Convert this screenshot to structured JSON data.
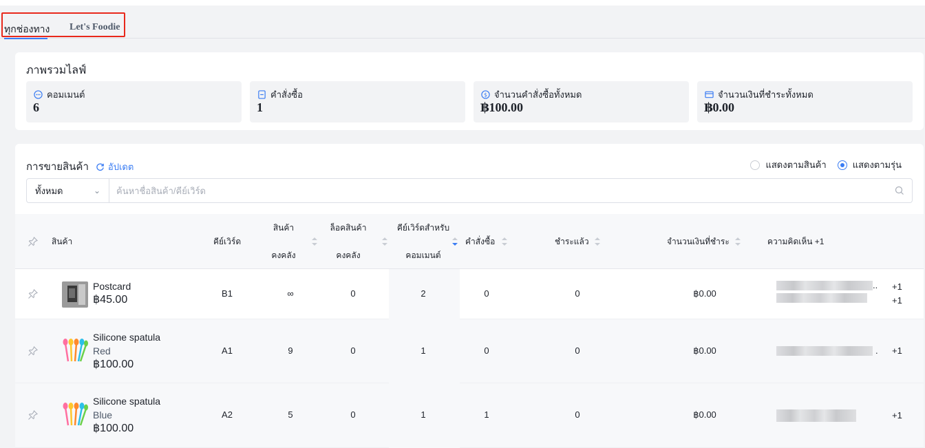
{
  "tabs": {
    "all": "ทุกช่องทาง",
    "store": "Let's Foodie"
  },
  "overview": {
    "title": "ภาพรวมไลฟ์",
    "stats": [
      {
        "label": "คอมเมนต์",
        "value": "6",
        "icon": "chat-bubble-icon"
      },
      {
        "label": "คำสั่งซื้อ",
        "value": "1",
        "icon": "order-doc-icon"
      },
      {
        "label": "จำนวนคำสั่งซื้อทั้งหมด",
        "value": "฿100.00",
        "icon": "dollar-circle-icon"
      },
      {
        "label": "จำนวนเงินที่ชำระทั้งหมด",
        "value": "฿0.00",
        "icon": "card-icon"
      }
    ]
  },
  "sales": {
    "title": "การขายสินค้า",
    "update_label": "อัปเดต",
    "radio": {
      "by_product": "แสดงตามสินค้า",
      "by_variant": "แสดงตามรุ่น",
      "selected": "by_variant"
    },
    "filter": {
      "select_value": "ทั้งหมด",
      "placeholder": "ค้นหาชื่อสินค้า/คีย์เวิร์ด"
    },
    "columns": {
      "product": "สินค้า",
      "keyword": "คีย์เวิร์ด",
      "stock_1": "สินค้า",
      "stock_2": "คงคลัง",
      "locked_1": "ล็อคสินค้า",
      "locked_2": "คงคลัง",
      "comment_kw_1": "คีย์เวิร์ดสำหรับ",
      "comment_kw_2": "คอมเมนต์",
      "orders": "คำสั่งซื้อ",
      "paid": "ชำระแล้ว",
      "amount_paid": "จำนวนเงินที่ชำระ",
      "comments": "ความคิดเห็น +1"
    },
    "rows": [
      {
        "name": "Postcard",
        "variant": "",
        "price": "฿45.00",
        "keyword": "B1",
        "stock": "∞",
        "locked": "0",
        "comment_kw": "2",
        "orders": "0",
        "paid": "0",
        "amount": "฿0.00",
        "more1": "+1",
        "more2": "+1",
        "dots": ".."
      },
      {
        "name": "Silicone spatula",
        "variant": "Red",
        "price": "฿100.00",
        "keyword": "A1",
        "stock": "9",
        "locked": "0",
        "comment_kw": "1",
        "orders": "0",
        "paid": "0",
        "amount": "฿0.00",
        "more1": "+1",
        "more2": "",
        "dots": "."
      },
      {
        "name": "Silicone spatula",
        "variant": "Blue",
        "price": "฿100.00",
        "keyword": "A2",
        "stock": "5",
        "locked": "0",
        "comment_kw": "1",
        "orders": "1",
        "paid": "0",
        "amount": "฿0.00",
        "more1": "+1",
        "more2": "",
        "dots": ""
      }
    ]
  },
  "colors": {
    "accent": "#3a7cf3",
    "highlight": "#e8281b"
  }
}
